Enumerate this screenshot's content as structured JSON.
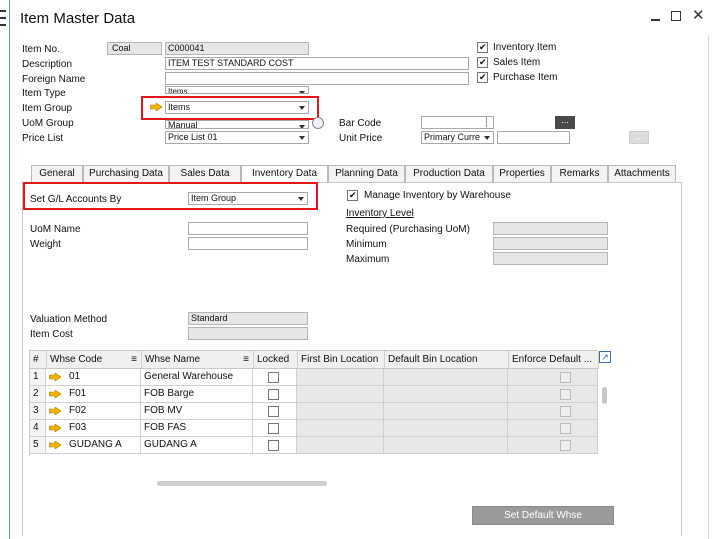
{
  "window": {
    "title": "Item Master Data"
  },
  "header": {
    "item_no_label": "Item No.",
    "item_no_series": "Coal",
    "item_no_value": "C000041",
    "description_label": "Description",
    "description_value": "ITEM TEST STANDARD COST",
    "foreign_name_label": "Foreign Name",
    "foreign_name_value": "",
    "item_type_label": "Item Type",
    "item_type_value": "Items",
    "item_group_label": "Item Group",
    "item_group_value": "Items",
    "uom_group_label": "UoM Group",
    "uom_group_value": "Manual",
    "price_list_label": "Price List",
    "price_list_value": "Price List 01",
    "bar_code_label": "Bar Code",
    "bar_code_value": "",
    "unit_price_label": "Unit Price",
    "unit_price_currency": "Primary Curre",
    "unit_price_value": "",
    "more_button": "...",
    "inventory_item_label": "Inventory Item",
    "sales_item_label": "Sales Item",
    "purchase_item_label": "Purchase Item"
  },
  "tabs": [
    "General",
    "Purchasing Data",
    "Sales Data",
    "Inventory Data",
    "Planning Data",
    "Production Data",
    "Properties",
    "Remarks",
    "Attachments"
  ],
  "inventory": {
    "gl_label": "Set G/L Accounts By",
    "gl_value": "Item Group",
    "manage_label": "Manage Inventory by Warehouse",
    "inventory_level_label": "Inventory Level",
    "required_label": "Required (Purchasing UoM)",
    "minimum_label": "Minimum",
    "maximum_label": "Maximum",
    "uom_name_label": "UoM Name",
    "weight_label": "Weight",
    "valuation_label": "Valuation Method",
    "valuation_value": "Standard",
    "item_cost_label": "Item Cost",
    "item_cost_value": ""
  },
  "grid": {
    "headers": [
      "#",
      "Whse Code",
      "Whse Name",
      "Locked",
      "First Bin Location",
      "Default Bin Location",
      "Enforce Default ..."
    ],
    "rows": [
      {
        "num": "1",
        "code": "01",
        "name": "General Warehouse"
      },
      {
        "num": "2",
        "code": "F01",
        "name": "FOB Barge"
      },
      {
        "num": "3",
        "code": "F02",
        "name": "FOB MV"
      },
      {
        "num": "4",
        "code": "F03",
        "name": "FOB FAS"
      },
      {
        "num": "5",
        "code": "GUDANG A",
        "name": "GUDANG A"
      }
    ]
  },
  "footer": {
    "set_default_whse": "Set Default Whse"
  },
  "colors": {
    "highlight": "#e01818",
    "link_arrow": "#f0b400"
  }
}
